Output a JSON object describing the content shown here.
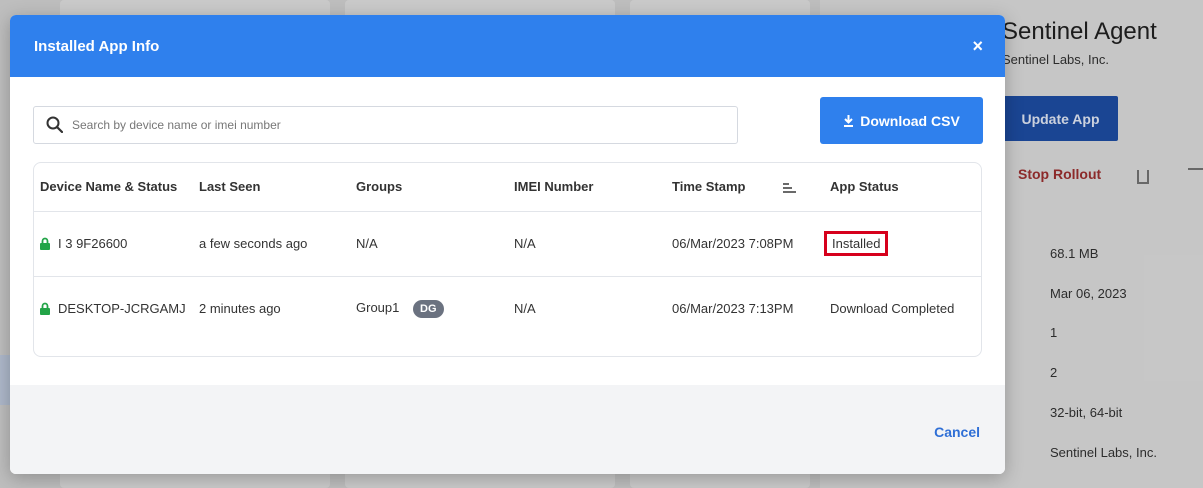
{
  "background": {
    "app_title": "Sentinel Agent",
    "app_vendor": "Sentinel Labs, Inc.",
    "update_button": "Update App",
    "stop_rollout": "Stop Rollout",
    "details": [
      "68.1 MB",
      "Mar 06, 2023",
      "1",
      "2",
      "32-bit, 64-bit",
      "Sentinel Labs, Inc."
    ]
  },
  "modal": {
    "title": "Installed App Info",
    "close_label": "×",
    "search_placeholder": "Search by device name or imei number",
    "download_label": "Download CSV",
    "cancel_label": "Cancel",
    "columns": [
      "Device Name & Status",
      "Last Seen",
      "Groups",
      "IMEI Number",
      "Time Stamp",
      "App Status"
    ],
    "rows": [
      {
        "device": "I                     3 9F26600",
        "last_seen": "a few seconds ago",
        "group": "N/A",
        "badge": "",
        "imei": "N/A",
        "timestamp": "06/Mar/2023 7:08PM",
        "status": "Installed"
      },
      {
        "device": "DESKTOP-JCRGAMJ",
        "last_seen": "2 minutes ago",
        "group": "Group1",
        "badge": "DG",
        "imei": "N/A",
        "timestamp": "06/Mar/2023 7:13PM",
        "status": "Download Completed"
      }
    ]
  },
  "colors": {
    "header_blue": "#2f80ed",
    "lock_green": "#22a447",
    "highlight_red": "#d6001c"
  }
}
